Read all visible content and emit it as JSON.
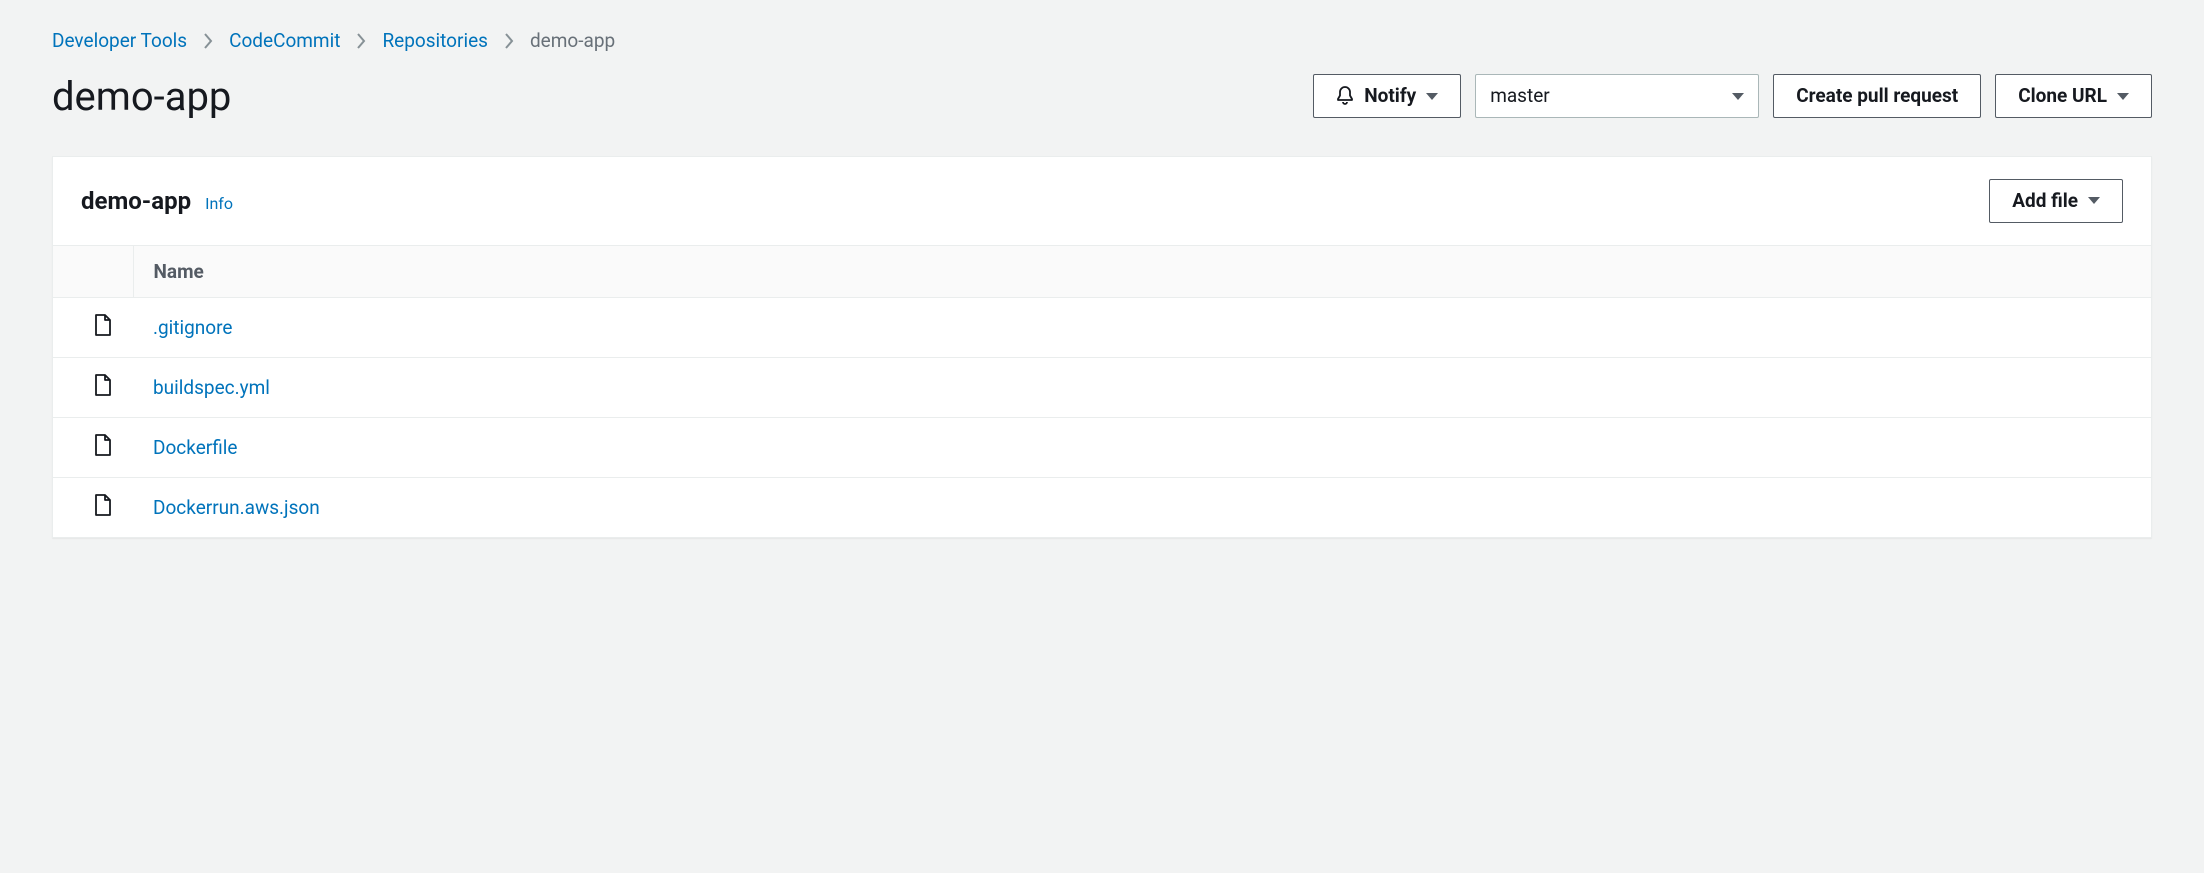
{
  "breadcrumb": {
    "items": [
      {
        "label": "Developer Tools"
      },
      {
        "label": "CodeCommit"
      },
      {
        "label": "Repositories"
      }
    ],
    "current": "demo-app"
  },
  "header": {
    "title": "demo-app",
    "notify_label": "Notify",
    "branch_selected": "master",
    "create_pr_label": "Create pull request",
    "clone_label": "Clone URL"
  },
  "panel": {
    "title": "demo-app",
    "info_label": "Info",
    "add_file_label": "Add file",
    "columns": {
      "name": "Name"
    },
    "files": [
      {
        "name": ".gitignore"
      },
      {
        "name": "buildspec.yml"
      },
      {
        "name": "Dockerfile"
      },
      {
        "name": "Dockerrun.aws.json"
      }
    ]
  }
}
